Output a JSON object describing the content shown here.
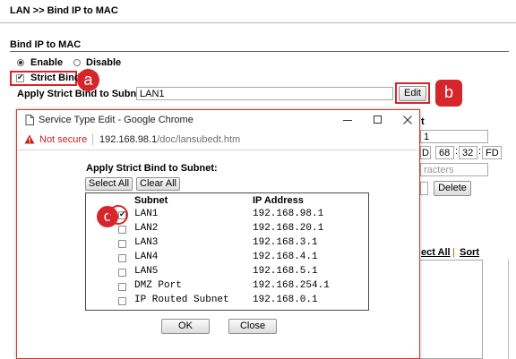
{
  "header": {
    "breadcrumb": "LAN >> Bind IP to MAC"
  },
  "section": {
    "title": "Bind IP to MAC",
    "enable_label": "Enable",
    "disable_label": "Disable",
    "strict_bind_label": "Strict Bind",
    "apply_label": "Apply Strict Bind to Subnet",
    "subnet_value": "LAN1",
    "edit_button": "Edit"
  },
  "background_fragments": {
    "col_header_partial": "t",
    "ip_partial": "1",
    "mac_parts": [
      "D",
      "68",
      "32",
      "FD"
    ],
    "comment_placeholder_partial": "racters",
    "delete_button": "Delete",
    "select_all_partial": "ect All",
    "sort_link": "Sort",
    "separator": "|"
  },
  "callouts": {
    "a": "a",
    "b": "b",
    "c": "c"
  },
  "popup": {
    "window_title": "Service Type Edit - Google Chrome",
    "security_label": "Not secure",
    "url_host": "192.168.98.1",
    "url_path": "/doc/lansubedt.htm",
    "heading": "Apply Strict Bind to Subnet:",
    "select_all": "Select All",
    "clear_all": "Clear All",
    "columns": {
      "subnet": "Subnet",
      "ip": "IP Address"
    },
    "rows": [
      {
        "subnet": "LAN1",
        "ip": "192.168.98.1",
        "checked": true
      },
      {
        "subnet": "LAN2",
        "ip": "192.168.20.1",
        "checked": false
      },
      {
        "subnet": "LAN3",
        "ip": "192.168.3.1",
        "checked": false
      },
      {
        "subnet": "LAN4",
        "ip": "192.168.4.1",
        "checked": false
      },
      {
        "subnet": "LAN5",
        "ip": "192.168.5.1",
        "checked": false
      },
      {
        "subnet": "DMZ Port",
        "ip": "192.168.254.1",
        "checked": false
      },
      {
        "subnet": "IP Routed Subnet",
        "ip": "192.168.0.1",
        "checked": false
      }
    ],
    "ok_button": "OK",
    "close_button": "Close"
  },
  "colors": {
    "accent_red": "#d6262b",
    "popup_border": "#cc3a3a"
  }
}
